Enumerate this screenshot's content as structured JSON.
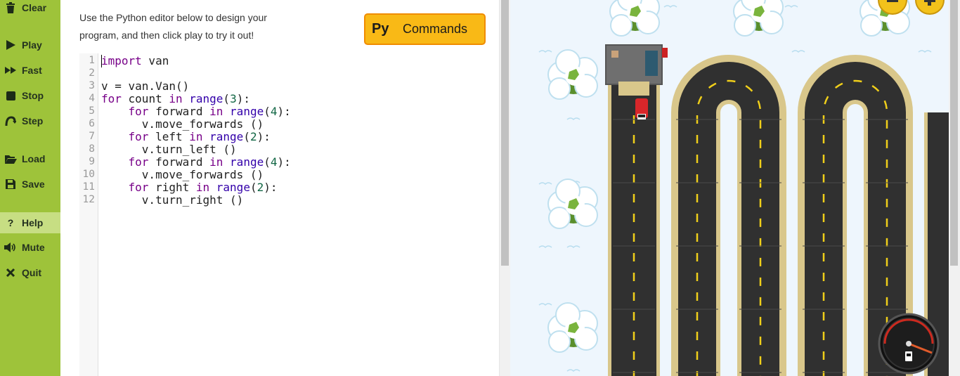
{
  "sidebar": {
    "items": [
      {
        "label": "Clear",
        "icon": "trash-icon"
      },
      {
        "label": "Play",
        "icon": "play-icon"
      },
      {
        "label": "Fast",
        "icon": "fast-forward-icon"
      },
      {
        "label": "Stop",
        "icon": "stop-icon"
      },
      {
        "label": "Step",
        "icon": "step-icon"
      },
      {
        "label": "Load",
        "icon": "folder-open-icon"
      },
      {
        "label": "Save",
        "icon": "save-icon"
      },
      {
        "label": "Help",
        "icon": "question-icon"
      },
      {
        "label": "Mute",
        "icon": "speaker-icon"
      },
      {
        "label": "Quit",
        "icon": "close-icon"
      }
    ],
    "bg_color": "#9ec33a",
    "active_color": "#c7de83"
  },
  "intro": {
    "line1": "Use the Python editor below to design your",
    "line2": "program, and then click play to try it out!"
  },
  "commands_button": {
    "py": "Py",
    "label": "Commands"
  },
  "editor": {
    "line_numbers": [
      "1",
      "2",
      "3",
      "4",
      "5",
      "6",
      "7",
      "8",
      "9",
      "10",
      "11",
      "12"
    ]
  },
  "game": {
    "zoom_out_icon": "minus-icon",
    "zoom_in_icon": "plus-icon",
    "fuel_gauge_icon": "fuel-gauge-icon",
    "fuel_pump_icon": "fuel-pump-icon"
  }
}
